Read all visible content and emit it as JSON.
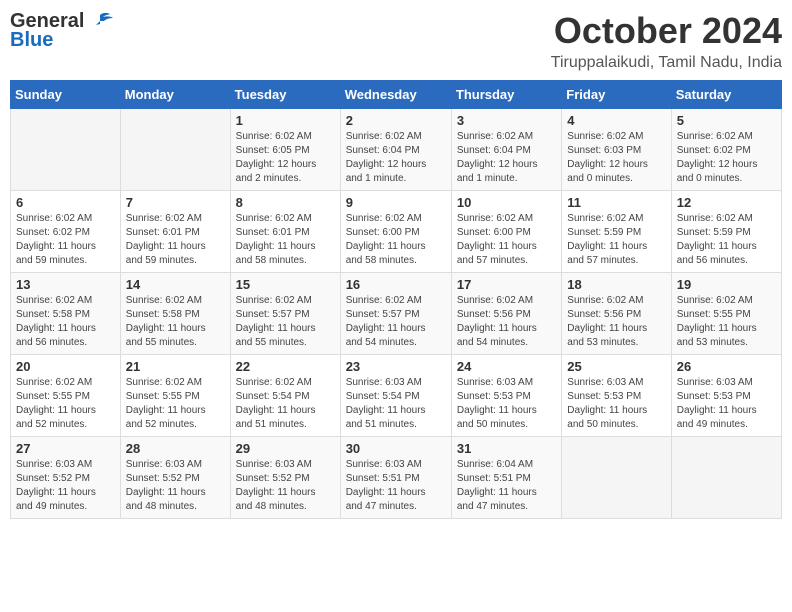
{
  "logo": {
    "general": "General",
    "blue": "Blue"
  },
  "title": "October 2024",
  "location": "Tiruppalaikudi, Tamil Nadu, India",
  "header_days": [
    "Sunday",
    "Monday",
    "Tuesday",
    "Wednesday",
    "Thursday",
    "Friday",
    "Saturday"
  ],
  "weeks": [
    [
      {
        "day": "",
        "content": ""
      },
      {
        "day": "",
        "content": ""
      },
      {
        "day": "1",
        "content": "Sunrise: 6:02 AM\nSunset: 6:05 PM\nDaylight: 12 hours\nand 2 minutes."
      },
      {
        "day": "2",
        "content": "Sunrise: 6:02 AM\nSunset: 6:04 PM\nDaylight: 12 hours\nand 1 minute."
      },
      {
        "day": "3",
        "content": "Sunrise: 6:02 AM\nSunset: 6:04 PM\nDaylight: 12 hours\nand 1 minute."
      },
      {
        "day": "4",
        "content": "Sunrise: 6:02 AM\nSunset: 6:03 PM\nDaylight: 12 hours\nand 0 minutes."
      },
      {
        "day": "5",
        "content": "Sunrise: 6:02 AM\nSunset: 6:02 PM\nDaylight: 12 hours\nand 0 minutes."
      }
    ],
    [
      {
        "day": "6",
        "content": "Sunrise: 6:02 AM\nSunset: 6:02 PM\nDaylight: 11 hours\nand 59 minutes."
      },
      {
        "day": "7",
        "content": "Sunrise: 6:02 AM\nSunset: 6:01 PM\nDaylight: 11 hours\nand 59 minutes."
      },
      {
        "day": "8",
        "content": "Sunrise: 6:02 AM\nSunset: 6:01 PM\nDaylight: 11 hours\nand 58 minutes."
      },
      {
        "day": "9",
        "content": "Sunrise: 6:02 AM\nSunset: 6:00 PM\nDaylight: 11 hours\nand 58 minutes."
      },
      {
        "day": "10",
        "content": "Sunrise: 6:02 AM\nSunset: 6:00 PM\nDaylight: 11 hours\nand 57 minutes."
      },
      {
        "day": "11",
        "content": "Sunrise: 6:02 AM\nSunset: 5:59 PM\nDaylight: 11 hours\nand 57 minutes."
      },
      {
        "day": "12",
        "content": "Sunrise: 6:02 AM\nSunset: 5:59 PM\nDaylight: 11 hours\nand 56 minutes."
      }
    ],
    [
      {
        "day": "13",
        "content": "Sunrise: 6:02 AM\nSunset: 5:58 PM\nDaylight: 11 hours\nand 56 minutes."
      },
      {
        "day": "14",
        "content": "Sunrise: 6:02 AM\nSunset: 5:58 PM\nDaylight: 11 hours\nand 55 minutes."
      },
      {
        "day": "15",
        "content": "Sunrise: 6:02 AM\nSunset: 5:57 PM\nDaylight: 11 hours\nand 55 minutes."
      },
      {
        "day": "16",
        "content": "Sunrise: 6:02 AM\nSunset: 5:57 PM\nDaylight: 11 hours\nand 54 minutes."
      },
      {
        "day": "17",
        "content": "Sunrise: 6:02 AM\nSunset: 5:56 PM\nDaylight: 11 hours\nand 54 minutes."
      },
      {
        "day": "18",
        "content": "Sunrise: 6:02 AM\nSunset: 5:56 PM\nDaylight: 11 hours\nand 53 minutes."
      },
      {
        "day": "19",
        "content": "Sunrise: 6:02 AM\nSunset: 5:55 PM\nDaylight: 11 hours\nand 53 minutes."
      }
    ],
    [
      {
        "day": "20",
        "content": "Sunrise: 6:02 AM\nSunset: 5:55 PM\nDaylight: 11 hours\nand 52 minutes."
      },
      {
        "day": "21",
        "content": "Sunrise: 6:02 AM\nSunset: 5:55 PM\nDaylight: 11 hours\nand 52 minutes."
      },
      {
        "day": "22",
        "content": "Sunrise: 6:02 AM\nSunset: 5:54 PM\nDaylight: 11 hours\nand 51 minutes."
      },
      {
        "day": "23",
        "content": "Sunrise: 6:03 AM\nSunset: 5:54 PM\nDaylight: 11 hours\nand 51 minutes."
      },
      {
        "day": "24",
        "content": "Sunrise: 6:03 AM\nSunset: 5:53 PM\nDaylight: 11 hours\nand 50 minutes."
      },
      {
        "day": "25",
        "content": "Sunrise: 6:03 AM\nSunset: 5:53 PM\nDaylight: 11 hours\nand 50 minutes."
      },
      {
        "day": "26",
        "content": "Sunrise: 6:03 AM\nSunset: 5:53 PM\nDaylight: 11 hours\nand 49 minutes."
      }
    ],
    [
      {
        "day": "27",
        "content": "Sunrise: 6:03 AM\nSunset: 5:52 PM\nDaylight: 11 hours\nand 49 minutes."
      },
      {
        "day": "28",
        "content": "Sunrise: 6:03 AM\nSunset: 5:52 PM\nDaylight: 11 hours\nand 48 minutes."
      },
      {
        "day": "29",
        "content": "Sunrise: 6:03 AM\nSunset: 5:52 PM\nDaylight: 11 hours\nand 48 minutes."
      },
      {
        "day": "30",
        "content": "Sunrise: 6:03 AM\nSunset: 5:51 PM\nDaylight: 11 hours\nand 47 minutes."
      },
      {
        "day": "31",
        "content": "Sunrise: 6:04 AM\nSunset: 5:51 PM\nDaylight: 11 hours\nand 47 minutes."
      },
      {
        "day": "",
        "content": ""
      },
      {
        "day": "",
        "content": ""
      }
    ]
  ]
}
